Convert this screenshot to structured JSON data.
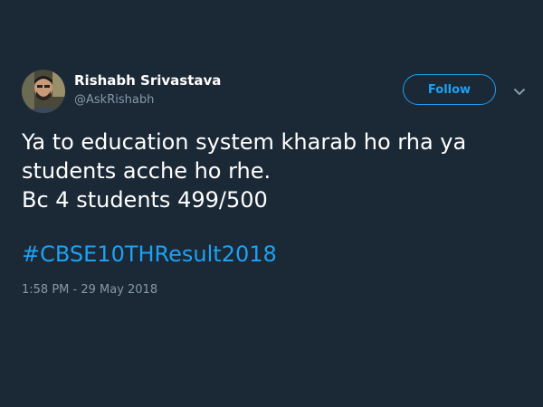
{
  "author": {
    "display_name": "Rishabh Srivastava",
    "handle": "@AskRishabh",
    "avatar_icon": "profile-photo"
  },
  "follow_button": {
    "label": "Follow",
    "color": "#1da1f2"
  },
  "menu": {
    "icon": "chevron-down-icon"
  },
  "tweet": {
    "lines": [
      "Ya to education system kharab ho rha ya",
      "students acche ho rhe.",
      "Bc 4 students 499/500"
    ],
    "hashtag": "#CBSE10THResult2018",
    "timestamp": "1:58 PM - 29 May 2018"
  },
  "theme": {
    "background": "#1b2836",
    "text": "#ffffff",
    "muted": "#8899a6",
    "accent": "#1da1f2"
  }
}
